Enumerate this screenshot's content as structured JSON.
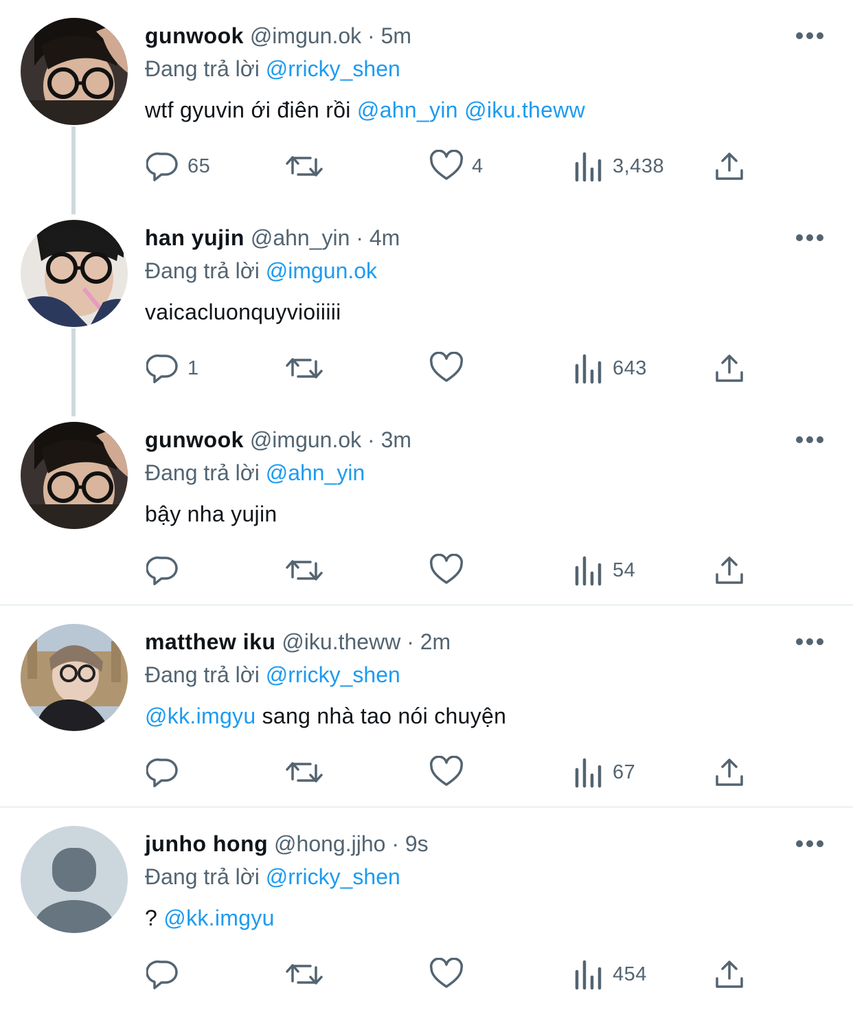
{
  "reply_prefix": "Đang trả lời",
  "colors": {
    "link": "#1d9bf0",
    "secondary": "#536471",
    "thread_line": "#cfd9de"
  },
  "tweets": [
    {
      "name": "gunwook",
      "handle": "@imgun.ok",
      "sep": "·",
      "time": "5m",
      "reply_to": "@rricky_shen",
      "text_before": "wtf gyuvin ới điên rồi",
      "mentions": "@ahn_yin @iku.theww",
      "text_after": "",
      "replies": "65",
      "retweets": "",
      "likes": "4",
      "views": "3,438",
      "avatar": "user-photo-glasses"
    },
    {
      "name": "han yujin",
      "handle": "@ahn_yin",
      "sep": "·",
      "time": "4m",
      "reply_to": "@imgun.ok",
      "text_before": "vaicacluonquyvioiiiii",
      "mentions": "",
      "text_after": "",
      "replies": "1",
      "retweets": "",
      "likes": "",
      "views": "643",
      "avatar": "user-photo-straw"
    },
    {
      "name": "gunwook",
      "handle": "@imgun.ok",
      "sep": "·",
      "time": "3m",
      "reply_to": "@ahn_yin",
      "text_before": "bậy nha yujin",
      "mentions": "",
      "text_after": "",
      "replies": "",
      "retweets": "",
      "likes": "",
      "views": "54",
      "avatar": "user-photo-glasses"
    },
    {
      "name": "matthew iku",
      "handle": "@iku.theww",
      "sep": "·",
      "time": "2m",
      "reply_to": "@rricky_shen",
      "text_before": "",
      "mentions": "@kk.imgyu",
      "text_after": " sang nhà tao nói chuyện",
      "replies": "",
      "retweets": "",
      "likes": "",
      "views": "67",
      "avatar": "user-photo-london"
    },
    {
      "name": "junho hong",
      "handle": "@hong.jjho",
      "sep": "·",
      "time": "9s",
      "reply_to": "@rricky_shen",
      "text_before": "? ",
      "mentions": "@kk.imgyu",
      "text_after": "",
      "replies": "",
      "retweets": "",
      "likes": "",
      "views": "454",
      "avatar": "default-avatar"
    }
  ]
}
